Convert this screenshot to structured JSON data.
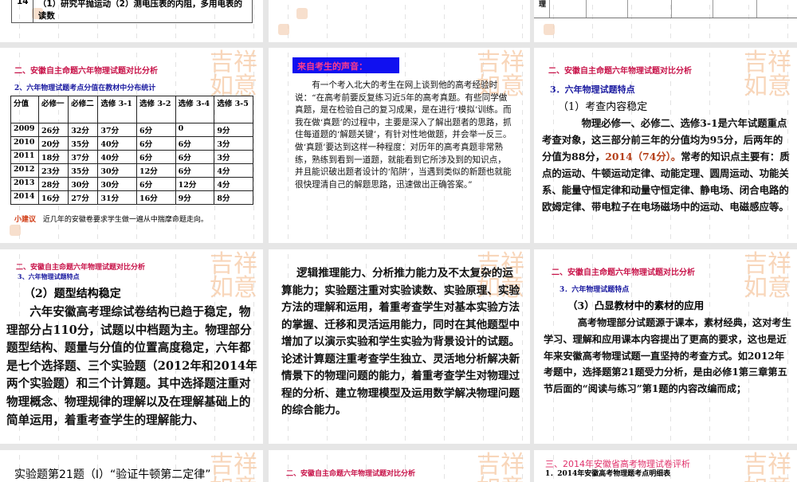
{
  "watermark": "吉祥如意",
  "slides": {
    "s0a": {
      "num": "14",
      "text": "（1）研究平抛运动（2）测电压表的内阻，多用电表的读数"
    },
    "s0c": {
      "cell": "理"
    },
    "s1a": {
      "title": "二、安徽自主命题六年物理试题对比分析",
      "subtitle": "2、六年物理试题考点分值在教材中分布统计",
      "headers": [
        "分值",
        "必修一",
        "必修二",
        "选修 3-1",
        "选修 3-2",
        "选修 3-4",
        "选修 3-5"
      ],
      "rows": [
        [
          "2009",
          "26分",
          "32分",
          "37分",
          "6分",
          "0",
          "9分"
        ],
        [
          "2010",
          "20分",
          "35分",
          "40分",
          "6分",
          "6分",
          "3分"
        ],
        [
          "2011",
          "18分",
          "37分",
          "40分",
          "6分",
          "6分",
          "3分"
        ],
        [
          "2012",
          "23分",
          "35分",
          "30分",
          "12分",
          "6分",
          "4分"
        ],
        [
          "2013",
          "28分",
          "30分",
          "30分",
          "6分",
          "12分",
          "4分"
        ],
        [
          "2014",
          "16分",
          "27分",
          "31分",
          "16分",
          "9分",
          "8分"
        ]
      ],
      "tip_label": "小建议",
      "tip": "近几年的安徽卷要求学生做一遍从中揣摩命题走向。"
    },
    "s1b": {
      "banner": "来自考生的声音：",
      "text": "有一个考入北大的考生在网上谈到他的高考经验时说：“在高考前要反复练习近5年的高考真题。有些同学做真题，是在检验自己的复习成果，是在进行‘模拟’训练。而我在做‘真题’的过程中，主要是深入了解出题者的思路，抓住每道题的‘解题关键’，有针对性地做题，并会举一反三。做‘真题’要达到这样一种程度：对历年的高考真题非常熟练，熟练到看到一道题，就能看到它所涉及到的知识点，并且能识破出题者设计的‘陷阱’，当遇到类似的新题也就能很快理清自己的解题思路，迅速做出正确答案。”"
    },
    "s1c": {
      "title": "二、安徽自主命题六年物理试题对比分析",
      "subtitle": "3．六年物理试题特点",
      "heading": "（1）考查内容稳定",
      "text1": "物理必修一、必修二、选修3-1是六年试题重点考查对象，这三部分前三年的分值均为95分，后两年的分值为88分，",
      "highlight": "2014（74分）。",
      "text2": "常考的知识点主要有：质点的运动、牛顿运动定律、动能定理、圆周运动、功能关系、能量守恒定律和动量守恒定律、静电场、闭合电路的欧姆定律、带电粒子在电场磁场中的运动、电磁感应等。"
    },
    "s2a": {
      "title": "二、安徽自主命题六年物理试题对比分析",
      "subtitle": "3、六年物理试题特点",
      "heading": "（2）题型结构稳定",
      "text": "六年安徽高考理综试卷结构已趋于稳定，物理部分占110分，试题以中档题为主。物理部分题型结构、题量与分值的位置高度稳定，六年都是七个选择题、三个实验题（2012年和2014年两个实验题）和三个计算题。其中选择题注重对物理概念、物理规律的理解以及在理解基础上的简单运用，着重考查学生的理解能力、"
    },
    "s2b": {
      "text": "逻辑推理能力、分析推力能力及不太复杂的运算能力；实验题注重对实验读数、实验原理、实验方法的理解和运用，着重考查学生对基本实验方法的掌握、迁移和灵活运用能力，同时在其他题型中增加了以演示实验和学生实验为背景设计的试题。论述计算题注重考查学生独立、灵活地分析解决新情景下的物理问题的能力，着重考查学生对物理过程的分析、建立物理模型及运用数学解决物理问题的综合能力。"
    },
    "s2c": {
      "title": "二、安徽自主命题六年物理试题对比分析",
      "subtitle": "3．六年物理试题特点",
      "heading": "（3）凸显教材中的素材的应用",
      "text": "高考物理部分试题源于课本，素材经典，这对考生学习、理解和应用课本内容提出了更高的要求，这也是近年来安徽高考物理试题一直坚持的考查方式。如2012年考题中，选择题第21题受力分析，是由必修1第三章第五节后面的“阅读与练习”第1题的内容改编而成；"
    },
    "s3a": {
      "text": "实验题第21题（Ⅰ）“验证牛顿第二定律”"
    },
    "s3b": {
      "title": "二、安徽自主命题六年物理试题对比分析"
    },
    "s3c": {
      "title": "三、2014年安徽省高考物理试卷评析",
      "subtitle": "1．2014年安徽高考物理题考点明细表"
    }
  }
}
